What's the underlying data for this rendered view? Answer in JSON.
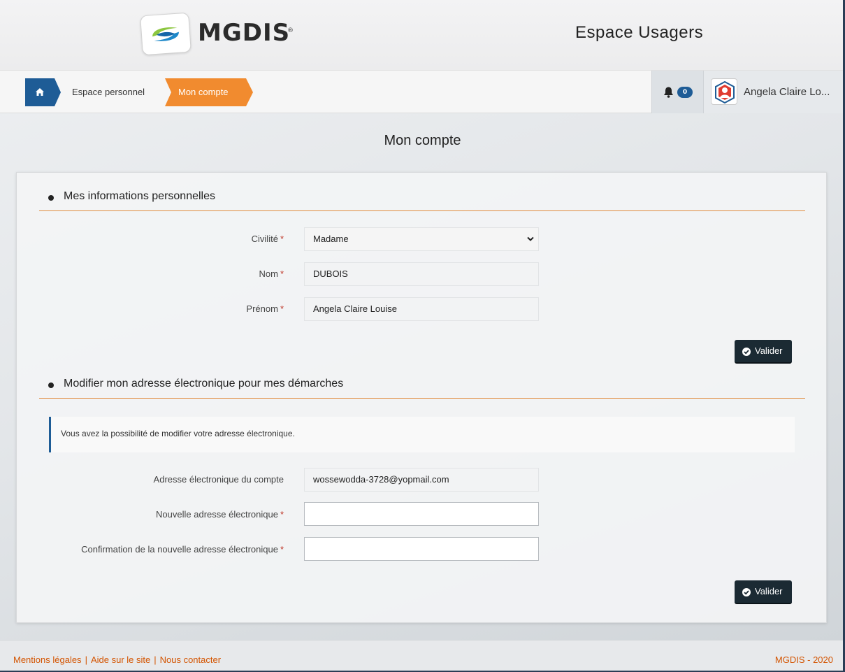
{
  "header": {
    "logo_text": "MGDIS",
    "logo_registered": "®",
    "site_title": "Espace Usagers"
  },
  "breadcrumb": {
    "home_icon": "home-icon",
    "items": [
      {
        "label": "Espace personnel"
      },
      {
        "label": "Mon compte"
      }
    ]
  },
  "notifications": {
    "icon": "bell-icon",
    "count": "0"
  },
  "user": {
    "name": "Angela Claire Lo..."
  },
  "page": {
    "title": "Mon compte"
  },
  "personal_section": {
    "title": "Mes informations personnelles",
    "civility_label": "Civilité",
    "civility_value": "Madame",
    "name_label": "Nom",
    "name_value": "DUBOIS",
    "firstname_label": "Prénom",
    "firstname_value": "Angela Claire Louise",
    "required_mark": "*",
    "submit_label": "Valider"
  },
  "email_section": {
    "title": "Modifier mon adresse électronique pour mes démarches",
    "info_text": "Vous avez la possibilité de modifier votre adresse électronique.",
    "current_label": "Adresse électronique du compte",
    "current_value": "wossewodda-3728@yopmail.com",
    "new_label": "Nouvelle adresse électronique",
    "new_value": "",
    "confirm_label": "Confirmation de la nouvelle adresse électronique",
    "confirm_value": "",
    "required_mark": "*",
    "submit_label": "Valider"
  },
  "footer": {
    "links": [
      {
        "label": "Mentions légales"
      },
      {
        "label": "Aide sur le site"
      },
      {
        "label": "Nous contacter"
      }
    ],
    "separator": "|",
    "copyright": "MGDIS - 2020"
  },
  "colors": {
    "primary_blue": "#1e5c96",
    "accent_orange": "#f18b2f",
    "button_dark": "#1b2a33",
    "footer_link": "#d35400",
    "required_red": "#c0392b"
  }
}
